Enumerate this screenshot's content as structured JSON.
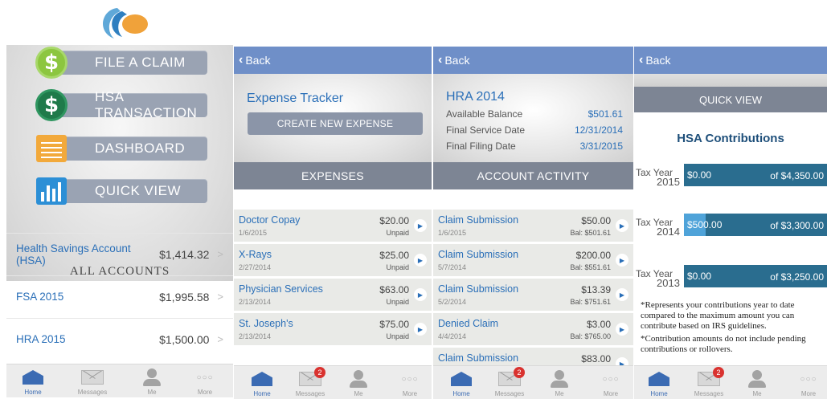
{
  "panel1": {
    "menu": [
      {
        "label": "FILE A CLAIM",
        "icon": "dollar-coin-light-icon"
      },
      {
        "label": "HSA TRANSACTION",
        "icon": "dollar-coin-dark-icon"
      },
      {
        "label": "DASHBOARD",
        "icon": "document-icon"
      },
      {
        "label": "QUICK VIEW",
        "icon": "bar-chart-icon"
      }
    ],
    "accounts_title": "ALL ACCOUNTS",
    "accounts": [
      {
        "name": "Health Savings Account (HSA)",
        "amount": "$1,414.32"
      },
      {
        "name": "FSA 2015",
        "amount": "$1,995.58"
      },
      {
        "name": "HRA 2015",
        "amount": "$1,500.00"
      }
    ]
  },
  "back_label": "Back",
  "panel2": {
    "title": "Expense Tracker",
    "create_label": "CREATE NEW EXPENSE",
    "section": "EXPENSES",
    "rows": [
      {
        "title": "Doctor Copay",
        "date": "1/6/2015",
        "amount": "$20.00",
        "status": "Unpaid"
      },
      {
        "title": "X-Rays",
        "date": "2/27/2014",
        "amount": "$25.00",
        "status": "Unpaid"
      },
      {
        "title": "Physician Services",
        "date": "2/13/2014",
        "amount": "$63.00",
        "status": "Unpaid"
      },
      {
        "title": "St. Joseph's",
        "date": "2/13/2014",
        "amount": "$75.00",
        "status": "Unpaid"
      }
    ]
  },
  "panel3": {
    "title": "HRA 2014",
    "details": [
      {
        "label": "Available Balance",
        "value": "$501.61"
      },
      {
        "label": "Final Service Date",
        "value": "12/31/2014"
      },
      {
        "label": "Final Filing Date",
        "value": "3/31/2015"
      }
    ],
    "section": "ACCOUNT ACTIVITY",
    "rows": [
      {
        "title": "Claim Submission",
        "date": "1/6/2015",
        "amount": "$50.00",
        "balance": "Bal: $501.61"
      },
      {
        "title": "Claim Submission",
        "date": "5/7/2014",
        "amount": "$200.00",
        "balance": "Bal: $551.61"
      },
      {
        "title": "Claim Submission",
        "date": "5/2/2014",
        "amount": "$13.39",
        "balance": "Bal: $751.61"
      },
      {
        "title": "Denied Claim",
        "date": "4/4/2014",
        "amount": "$3.00",
        "balance": "Bal: $765.00"
      },
      {
        "title": "Claim Submission",
        "date": "",
        "amount": "$83.00",
        "balance": ""
      }
    ]
  },
  "panel4": {
    "quick_view": "QUICK VIEW",
    "title": "HSA Contributions",
    "tax_year_label": "Tax Year",
    "contributions": [
      {
        "year": "2015",
        "current": "$0.00",
        "max": "of $4,350.00",
        "fraction": 0.0
      },
      {
        "year": "2014",
        "current": "$500.00",
        "max": "of $3,300.00",
        "fraction": 0.15
      },
      {
        "year": "2013",
        "current": "$0.00",
        "max": "of $3,250.00",
        "fraction": 0.0
      }
    ],
    "note1": "*Represents your contributions year to date compared to the maximum amount you can contribute based on IRS guidelines.",
    "note2": "*Contribution amounts do not include pending contributions or rollovers."
  },
  "tabs": {
    "home": "Home",
    "messages": "Messages",
    "me": "Me",
    "more": "More",
    "messages_badge": "2",
    "dots": "○○○"
  },
  "colors": {
    "accent": "#2a6fb8",
    "navbar": "#6f8fc8",
    "section_bar": "#7d8594"
  }
}
